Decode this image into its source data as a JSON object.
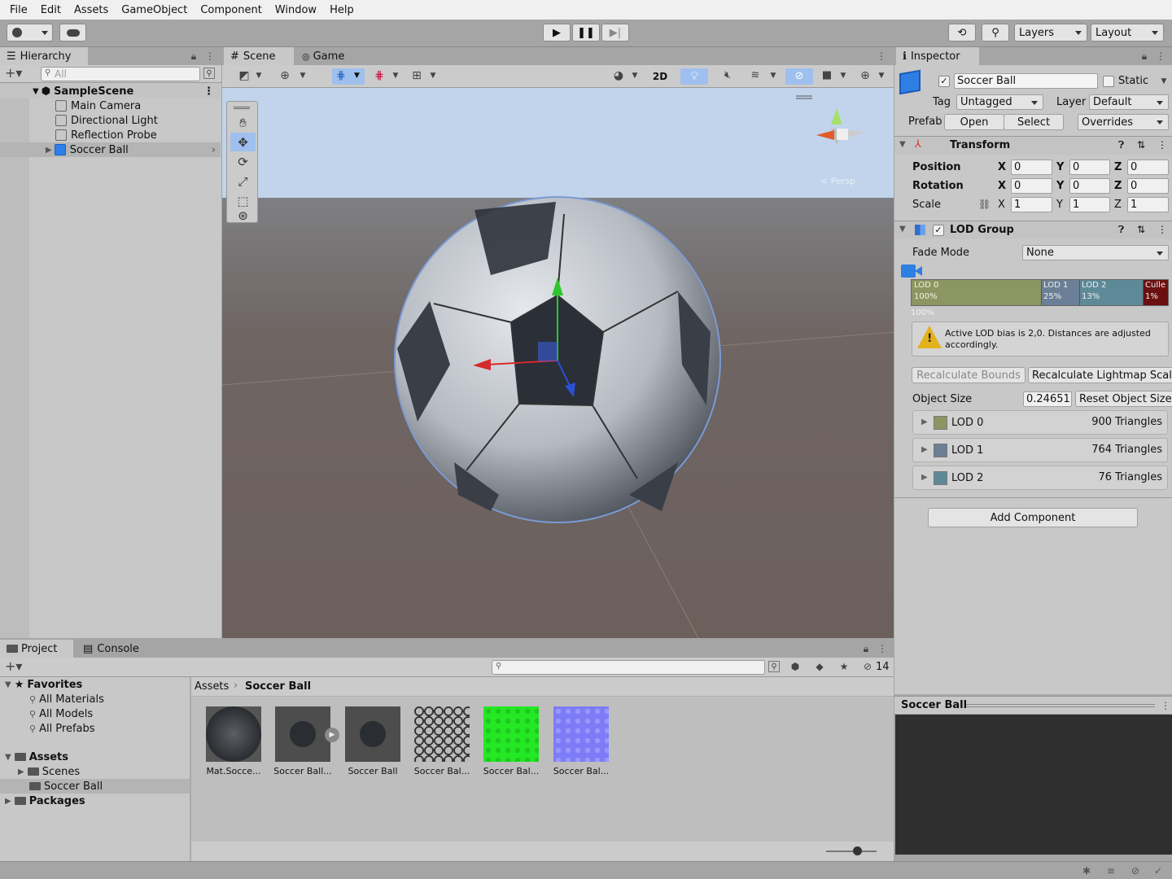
{
  "menu": [
    "File",
    "Edit",
    "Assets",
    "GameObject",
    "Component",
    "Window",
    "Help"
  ],
  "toolbar": {
    "layers_label": "Layers",
    "layout_label": "Layout"
  },
  "hierarchy": {
    "tab_label": "Hierarchy",
    "search_placeholder": "All",
    "scene_name": "SampleScene",
    "items": [
      "Main Camera",
      "Directional Light",
      "Reflection Probe",
      "Soccer Ball"
    ]
  },
  "scene": {
    "tab_scene": "Scene",
    "tab_game": "Game",
    "btn_2d": "2D",
    "persp_label": "< Persp"
  },
  "inspector": {
    "tab_label": "Inspector",
    "object_name": "Soccer Ball",
    "static_label": "Static",
    "tag_label": "Tag",
    "tag_value": "Untagged",
    "layer_label": "Layer",
    "layer_value": "Default",
    "prefab_label": "Prefab",
    "open_label": "Open",
    "select_label": "Select",
    "overrides_label": "Overrides",
    "transform": {
      "title": "Transform",
      "position_label": "Position",
      "rotation_label": "Rotation",
      "scale_label": "Scale",
      "x": "X",
      "y": "Y",
      "z": "Z",
      "position": [
        "0",
        "0",
        "0"
      ],
      "rotation": [
        "0",
        "0",
        "0"
      ],
      "scale": [
        "1",
        "1",
        "1"
      ]
    },
    "lod_group": {
      "title": "LOD Group",
      "fade_mode_label": "Fade Mode",
      "fade_mode_value": "None",
      "lods": [
        {
          "name": "LOD 0",
          "pct": "100%",
          "color": "#8c9662"
        },
        {
          "name": "LOD 1",
          "pct": "25%",
          "color": "#6b7f96"
        },
        {
          "name": "LOD 2",
          "pct": "13%",
          "color": "#5e8a98"
        },
        {
          "name": "Culle",
          "pct": "1%",
          "color": "#6b1010"
        }
      ],
      "percent_under": "100%",
      "warning_text": "Active LOD bias is 2,0. Distances are adjusted accordingly.",
      "recalc_bounds": "Recalculate Bounds",
      "recalc_lightmap": "Recalculate Lightmap Scale",
      "object_size_label": "Object Size",
      "object_size_value": "0.24651",
      "reset_object_size": "Reset Object Size",
      "rows": [
        {
          "name": "LOD 0",
          "tris": "900 Triangles",
          "color": "#8c9662"
        },
        {
          "name": "LOD 1",
          "tris": "764 Triangles",
          "color": "#6b7f96"
        },
        {
          "name": "LOD 2",
          "tris": "76 Triangles",
          "color": "#5e8a98"
        }
      ]
    },
    "add_component": "Add Component",
    "preview_title": "Soccer Ball"
  },
  "project": {
    "tab_project": "Project",
    "tab_console": "Console",
    "hidden_count": "14",
    "favorites_label": "Favorites",
    "favorites": [
      "All Materials",
      "All Models",
      "All Prefabs"
    ],
    "assets_label": "Assets",
    "folders": [
      "Scenes",
      "Soccer Ball"
    ],
    "packages_label": "Packages",
    "breadcrumb": [
      "Assets",
      "Soccer Ball"
    ],
    "items": [
      "Mat.Socce...",
      "Soccer Ball...",
      "Soccer Ball",
      "Soccer Bal...",
      "Soccer Bal...",
      "Soccer Bal..."
    ]
  }
}
